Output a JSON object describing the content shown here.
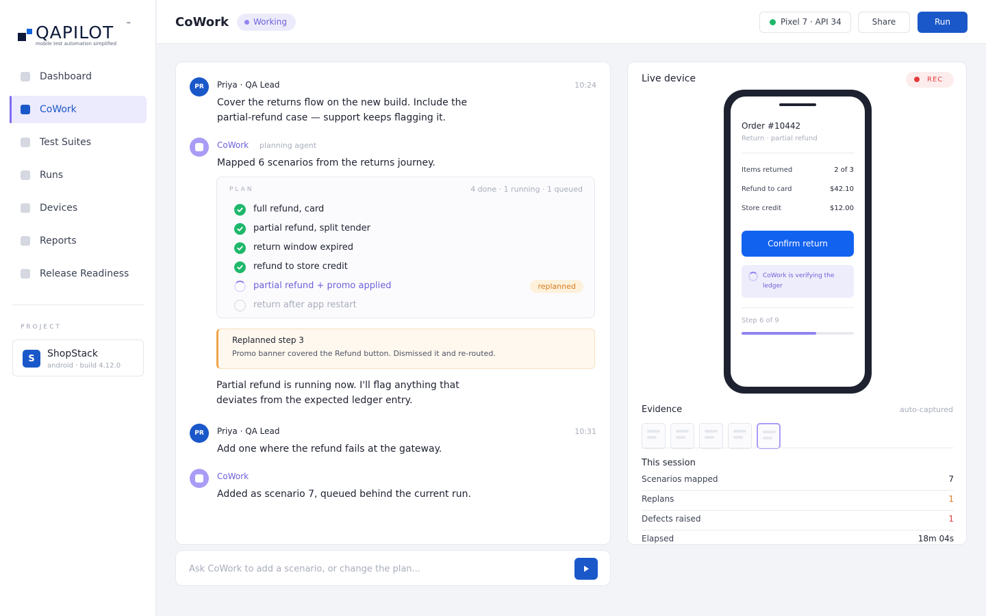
{
  "brand": {
    "name": "QAPILOT",
    "trademark": "™",
    "tagline": "mobile test automation simplified"
  },
  "sidebar": {
    "items": [
      {
        "label": "Dashboard",
        "active": false
      },
      {
        "label": "CoWork",
        "active": true
      },
      {
        "label": "Test Suites",
        "active": false
      },
      {
        "label": "Runs",
        "active": false
      },
      {
        "label": "Devices",
        "active": false
      },
      {
        "label": "Reports",
        "active": false
      },
      {
        "label": "Release Readiness",
        "active": false
      }
    ],
    "project_label": "PROJECT",
    "project": {
      "initial": "S",
      "name": "ShopStack",
      "meta": "android · build 4.12.0"
    }
  },
  "header": {
    "title": "CoWork",
    "status": "Working",
    "device": "Pixel 7 · API 34",
    "share_label": "Share",
    "run_label": "Run"
  },
  "chat": {
    "messages": [
      {
        "avatar": "PR",
        "author": "Priya · QA Lead",
        "time": "10:24",
        "text": "Cover the returns flow on the new build. Include the partial-refund case — support keeps flagging it."
      },
      {
        "author": "CoWork",
        "role": "planning agent",
        "text": "Mapped 6 scenarios from the returns journey."
      },
      {
        "avatar": "PR",
        "author": "Priya · QA Lead",
        "time": "10:31",
        "text": "Add one where the refund fails at the gateway."
      },
      {
        "author": "CoWork",
        "text": "Added as scenario 7, queued behind the current run."
      }
    ],
    "plan": {
      "label": "PLAN",
      "summary": "4 done · 1 running · 1 queued",
      "steps": [
        {
          "label": "full refund, card",
          "state": "done"
        },
        {
          "label": "partial refund, split tender",
          "state": "done"
        },
        {
          "label": "return window expired",
          "state": "done"
        },
        {
          "label": "refund to store credit",
          "state": "done"
        },
        {
          "label": "partial refund + promo applied",
          "state": "running",
          "tag": "replanned"
        },
        {
          "label": "return after app restart",
          "state": "queued"
        }
      ]
    },
    "notice": {
      "title": "Replanned step 3",
      "body": "Promo banner covered the Refund button. Dismissed it and re-routed."
    },
    "followup": "Partial refund is running now. I'll flag anything that deviates from the expected ledger entry."
  },
  "composer": {
    "placeholder": "Ask CoWork to add a scenario, or change the plan..."
  },
  "device_panel": {
    "title": "Live device",
    "rec_label": "REC",
    "screen": {
      "order_title": "Order #10442",
      "order_sub": "Return · partial refund",
      "rows": [
        {
          "label": "Items returned",
          "value": "2 of 3"
        },
        {
          "label": "Refund to card",
          "value": "$42.10"
        },
        {
          "label": "Store credit",
          "value": "$12.00"
        }
      ],
      "confirm_label": "Confirm return",
      "verify_text": "CoWork is verifying the ledger",
      "step_label": "Step 6 of 9",
      "progress": 0.667
    },
    "evidence_title": "Evidence",
    "evidence_note": "auto-captured",
    "evidence_count": 5,
    "session_title": "This session",
    "stats": [
      {
        "label": "Scenarios mapped",
        "value": "7",
        "tone": "normal"
      },
      {
        "label": "Replans",
        "value": "1",
        "tone": "warn"
      },
      {
        "label": "Defects raised",
        "value": "1",
        "tone": "bad"
      },
      {
        "label": "Elapsed",
        "value": "18m 04s",
        "tone": "normal"
      }
    ]
  },
  "colors": {
    "primary": "#1a58c9",
    "accent": "#7b6cf0",
    "success": "#1fb86b",
    "warning": "#d77a1e",
    "danger": "#e23c3c"
  }
}
